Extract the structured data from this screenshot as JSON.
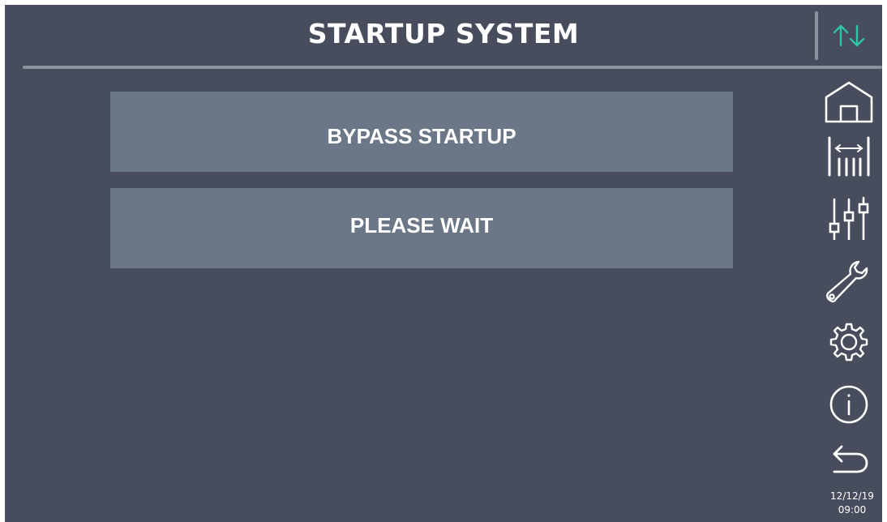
{
  "header": {
    "title": "STARTUP SYSTEM"
  },
  "panels": {
    "bypass_label": "BYPASS STARTUP",
    "status_label": "PLEASE WAIT"
  },
  "sidebar": {
    "items": [
      {
        "icon": "transfer-arrows-icon"
      },
      {
        "icon": "home-icon"
      },
      {
        "icon": "meters-icon"
      },
      {
        "icon": "sliders-icon"
      },
      {
        "icon": "wrench-icon"
      },
      {
        "icon": "gear-icon"
      },
      {
        "icon": "info-icon"
      },
      {
        "icon": "back-arrow-icon"
      }
    ]
  },
  "status": {
    "date": "12/12/19",
    "time": "09:00"
  },
  "colors": {
    "background": "#474d5c",
    "panel": "#6b7686",
    "accent": "#2ec4a4",
    "text": "#ffffff"
  }
}
